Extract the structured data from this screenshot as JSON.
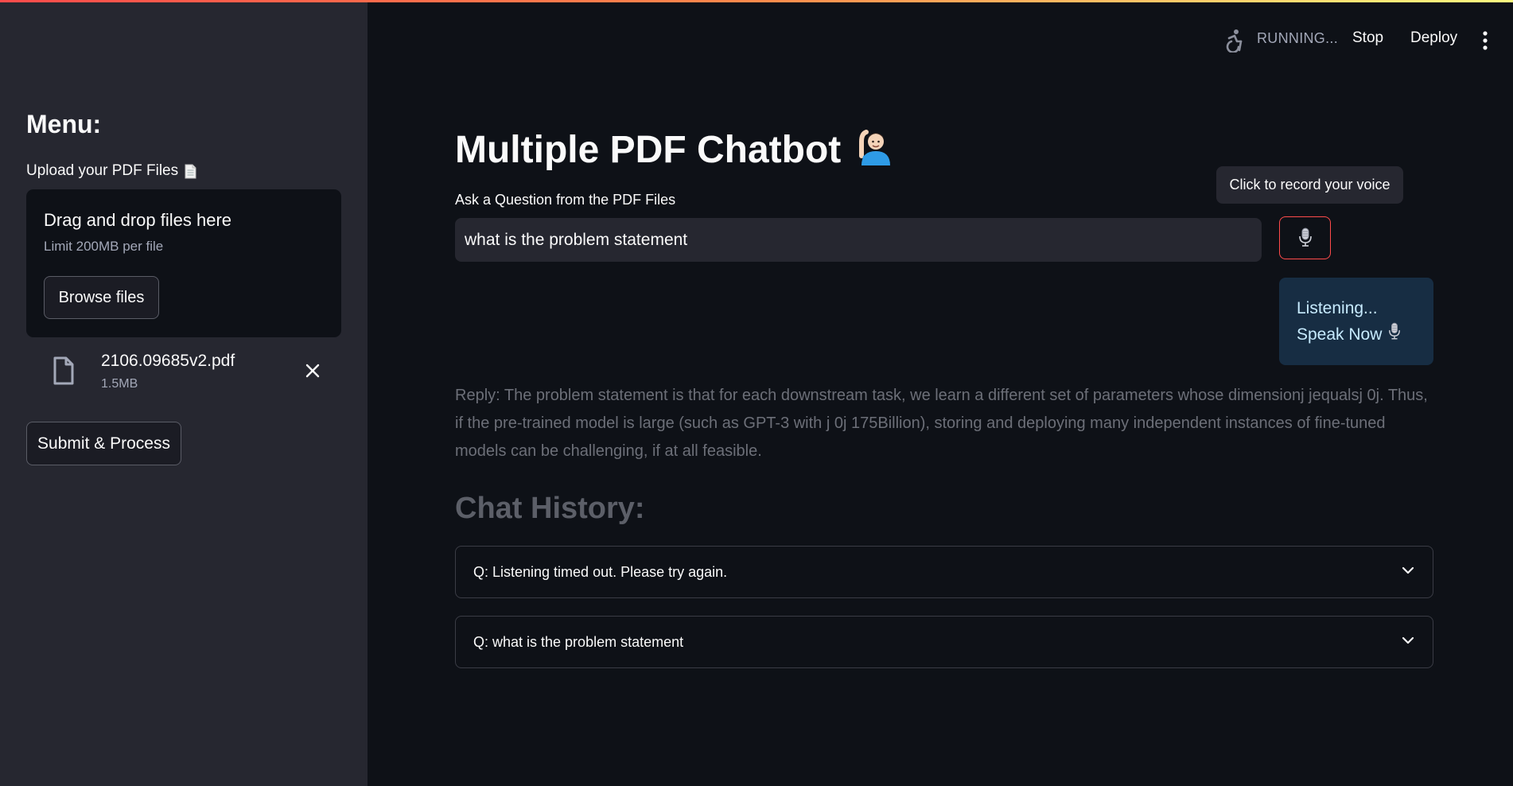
{
  "header": {
    "status_text": "RUNNING...",
    "stop_label": "Stop",
    "deploy_label": "Deploy",
    "running_icon": "accessibility-running-icon",
    "menu_icon": "kebab-menu-icon"
  },
  "sidebar": {
    "menu_title": "Menu:",
    "upload_label": "Upload your PDF Files",
    "upload_icon": "page-icon",
    "dropzone": {
      "title": "Drag and drop files here",
      "limit": "Limit 200MB per file",
      "browse_label": "Browse files"
    },
    "uploaded_file": {
      "name": "2106.09685v2.pdf",
      "size": "1.5MB"
    },
    "submit_label": "Submit & Process"
  },
  "main": {
    "title": "Multiple PDF Chatbot",
    "title_emoji": "🙋🏻‍♂️",
    "question_label": "Ask a Question from the PDF Files",
    "question_value": "what is the problem statement",
    "tooltip": "Click to record your voice",
    "mic_icon": "microphone-icon",
    "listening": {
      "line1": "Listening...",
      "line2": "Speak Now",
      "icon": "microphone-icon"
    },
    "reply": "Reply: The problem statement is that for each downstream task, we learn a different set of parameters whose dimensionj jequalsj 0j. Thus, if the pre-trained model is large (such as GPT-3 with j 0j 175Billion), storing and deploying many independent instances of fine-tuned models can be challenging, if at all feasible.",
    "history_title": "Chat History:",
    "history": [
      {
        "label": "Q: Listening timed out. Please try again."
      },
      {
        "label": "Q: what is the problem statement"
      }
    ]
  },
  "colors": {
    "accent": "#ff4b4b",
    "background": "#0e1117",
    "sidebar": "#262730",
    "info_box": "#172d43"
  }
}
